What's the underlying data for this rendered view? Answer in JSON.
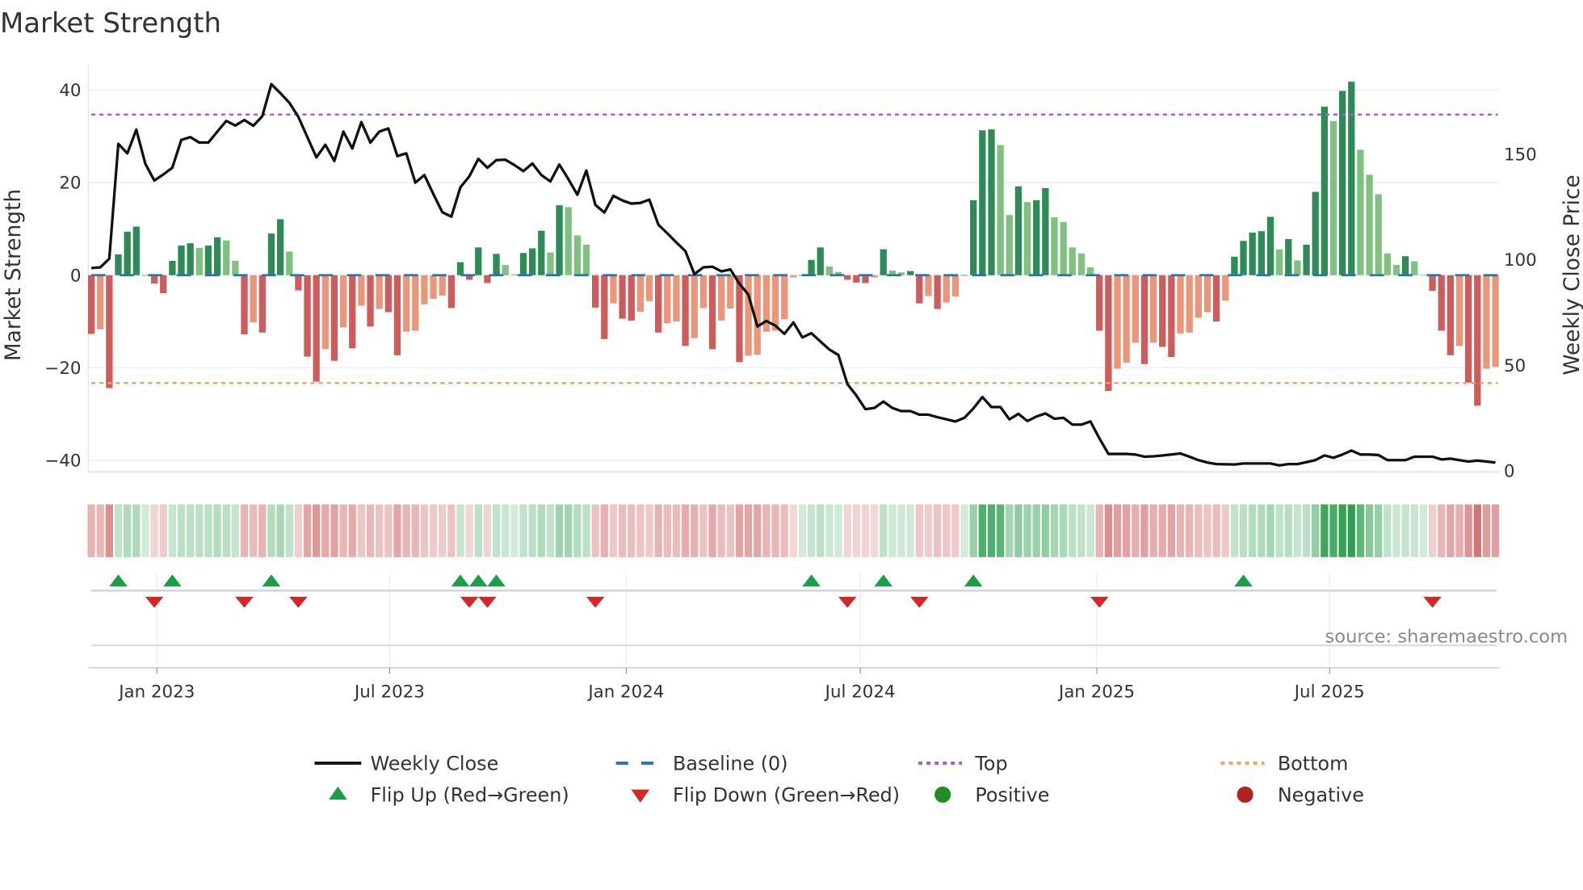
{
  "chart_data": {
    "type": "bar",
    "title": "Market Strength",
    "ylabel": "Market Strength",
    "y2label": "Weekly Close Price",
    "ylim": [
      -42.5,
      45.2
    ],
    "y2lim": [
      -0.5,
      191.8
    ],
    "yticks": [
      "40",
      "20",
      "0",
      "−20",
      "−40"
    ],
    "ytick_values": [
      40,
      20,
      0,
      -20,
      -40
    ],
    "y2ticks": [
      "150",
      "100",
      "50",
      "0"
    ],
    "y2tick_values": [
      150,
      100,
      50,
      0
    ],
    "xticks": [
      "Jan 2023",
      "Jul 2023",
      "Jan 2024",
      "Jul 2024",
      "Jan 2025",
      "Jul 2025"
    ],
    "xtick_dates": [
      "2023-01-01",
      "2023-07-01",
      "2024-01-01",
      "2024-07-01",
      "2025-01-01",
      "2025-07-01"
    ],
    "grid": true,
    "legend_placement": "bottom",
    "source": "source: sharemaestro.com",
    "top_level": 34.7,
    "bottom_level": -23.3,
    "baseline": 0,
    "colors": {
      "positive_strong": "#2e8b57",
      "positive_weak": "#80c080",
      "negative_strong": "#cd5c5c",
      "negative_weak": "#e9967a",
      "weekly_close": "#111111",
      "baseline": "#1f77b4",
      "top": "#9b5de5",
      "bottom": "#f4a261",
      "flip_up": "#1a9e4a",
      "flip_down": "#d62728",
      "positive": "#228b22",
      "negative": "#b22222"
    },
    "dates": [
      "2022-11-11",
      "2022-11-18",
      "2022-11-25",
      "2022-12-02",
      "2022-12-09",
      "2022-12-16",
      "2022-12-23",
      "2022-12-30",
      "2023-01-06",
      "2023-01-13",
      "2023-01-20",
      "2023-01-27",
      "2023-02-03",
      "2023-02-10",
      "2023-02-17",
      "2023-02-24",
      "2023-03-03",
      "2023-03-10",
      "2023-03-17",
      "2023-03-24",
      "2023-03-31",
      "2023-04-07",
      "2023-04-14",
      "2023-04-21",
      "2023-04-28",
      "2023-05-05",
      "2023-05-12",
      "2023-05-19",
      "2023-05-26",
      "2023-06-02",
      "2023-06-09",
      "2023-06-16",
      "2023-06-23",
      "2023-06-30",
      "2023-07-07",
      "2023-07-14",
      "2023-07-21",
      "2023-07-28",
      "2023-08-04",
      "2023-08-11",
      "2023-08-18",
      "2023-08-25",
      "2023-09-01",
      "2023-09-08",
      "2023-09-15",
      "2023-09-22",
      "2023-09-29",
      "2023-10-06",
      "2023-10-13",
      "2023-10-20",
      "2023-10-27",
      "2023-11-03",
      "2023-11-10",
      "2023-11-17",
      "2023-11-24",
      "2023-12-01",
      "2023-12-08",
      "2023-12-15",
      "2023-12-22",
      "2023-12-29",
      "2024-01-05",
      "2024-01-12",
      "2024-01-19",
      "2024-01-26",
      "2024-02-02",
      "2024-02-09",
      "2024-02-16",
      "2024-02-23",
      "2024-03-01",
      "2024-03-08",
      "2024-03-15",
      "2024-03-22",
      "2024-03-29",
      "2024-04-05",
      "2024-04-12",
      "2024-04-19",
      "2024-04-26",
      "2024-05-03",
      "2024-05-10",
      "2024-05-17",
      "2024-05-24",
      "2024-05-31",
      "2024-06-07",
      "2024-06-14",
      "2024-06-21",
      "2024-06-28",
      "2024-07-05",
      "2024-07-12",
      "2024-07-19",
      "2024-07-26",
      "2024-08-02",
      "2024-08-09",
      "2024-08-16",
      "2024-08-23",
      "2024-08-30",
      "2024-09-06",
      "2024-09-13",
      "2024-09-20",
      "2024-09-27",
      "2024-10-04",
      "2024-10-11",
      "2024-10-18",
      "2024-10-25",
      "2024-11-01",
      "2024-11-08",
      "2024-11-15",
      "2024-11-22",
      "2024-11-29",
      "2024-12-06",
      "2024-12-13",
      "2024-12-20",
      "2024-12-27",
      "2025-01-03",
      "2025-01-10",
      "2025-01-17",
      "2025-01-24",
      "2025-01-31",
      "2025-02-07",
      "2025-02-14",
      "2025-02-21",
      "2025-02-28",
      "2025-03-07",
      "2025-03-14",
      "2025-03-21",
      "2025-03-28",
      "2025-04-04",
      "2025-04-11",
      "2025-04-18",
      "2025-04-25",
      "2025-05-02",
      "2025-05-09",
      "2025-05-16",
      "2025-05-23",
      "2025-05-30",
      "2025-06-06",
      "2025-06-13",
      "2025-06-20",
      "2025-06-27",
      "2025-07-04",
      "2025-07-11",
      "2025-07-18",
      "2025-07-25",
      "2025-08-01",
      "2025-08-08",
      "2025-08-15",
      "2025-08-22",
      "2025-08-29",
      "2025-09-05",
      "2025-09-12",
      "2025-09-19",
      "2025-09-26",
      "2025-10-03",
      "2025-10-10",
      "2025-10-17",
      "2025-10-24",
      "2025-10-31",
      "2025-11-07"
    ],
    "strength": [
      -12.7,
      -11.7,
      -24.4,
      4.5,
      9.4,
      10.5,
      0,
      -1.8,
      -3.9,
      3.1,
      6.4,
      6.9,
      5.9,
      6.4,
      8.2,
      7.5,
      3.1,
      -12.8,
      -10.2,
      -12.4,
      9.0,
      12.1,
      5.1,
      -3.3,
      -17.6,
      -23.0,
      -16.0,
      -18.5,
      -11.3,
      -15.8,
      -6.6,
      -11.1,
      -7.3,
      -8.0,
      -17.3,
      -12.2,
      -12.0,
      -6.3,
      -5.1,
      -4.4,
      -7.1,
      2.8,
      -1.0,
      6.0,
      -1.7,
      4.6,
      2.2,
      0.2,
      4.8,
      5.8,
      9.6,
      4.9,
      15.1,
      14.7,
      8.6,
      6.6,
      -7.0,
      -13.8,
      -6.1,
      -9.4,
      -9.8,
      -7.9,
      -5.6,
      -12.4,
      -10.4,
      -10.0,
      -15.3,
      -13.6,
      -7.1,
      -16.0,
      -9.8,
      -7.2,
      -18.8,
      -17.4,
      -17.2,
      -12.2,
      -12.0,
      -9.5,
      -0.5,
      0,
      3.3,
      6.0,
      1.9,
      0.7,
      -1.0,
      -1.6,
      -1.7,
      -0.5,
      5.6,
      1.0,
      0.6,
      0.9,
      -6.1,
      -4.5,
      -7.3,
      -5.9,
      -4.6,
      0,
      16.2,
      31.3,
      31.5,
      28.1,
      13.0,
      19.2,
      15.8,
      16.2,
      18.8,
      12.5,
      11.5,
      6.0,
      4.7,
      1.7,
      -12.0,
      -25.0,
      -20.2,
      -18.9,
      -14.6,
      -19.2,
      -14.6,
      -15.5,
      -17.7,
      -12.6,
      -12.4,
      -9.2,
      -8.0,
      -10.0,
      -5.5,
      4.0,
      7.4,
      9.2,
      9.5,
      12.6,
      5.6,
      7.8,
      3.2,
      6.6,
      18.0,
      36.4,
      33.3,
      39.8,
      41.8,
      27.1,
      21.7,
      17.5,
      4.7,
      2.2,
      4.1,
      3.0,
      0.1,
      -3.4,
      -12.0,
      -17.3,
      -15.3,
      -23.2,
      -28.2,
      -20.2,
      -19.8
    ],
    "weekly_close": [
      96.1,
      96.4,
      100.5,
      154.9,
      150.4,
      161.6,
      145.5,
      137.5,
      140.4,
      143.6,
      156.8,
      158.1,
      155.5,
      155.5,
      160.7,
      165.8,
      163.6,
      166.2,
      163.5,
      168.0,
      183.2,
      178.9,
      174.4,
      167.7,
      158.1,
      148.5,
      154.5,
      146.8,
      160.7,
      152.7,
      165.2,
      155.5,
      160.7,
      162.2,
      149.1,
      150.4,
      136.5,
      140.1,
      131.1,
      122.5,
      120.4,
      134.3,
      139.5,
      147.8,
      143.6,
      147.2,
      147.4,
      144.9,
      142.0,
      145.6,
      140.1,
      137.1,
      145.1,
      138.2,
      130.8,
      142.3,
      126.0,
      122.4,
      130.3,
      128.1,
      126.6,
      126.9,
      128.5,
      116.6,
      112.5,
      108.2,
      104.1,
      93.2,
      96.4,
      96.7,
      94.5,
      95.4,
      88.7,
      83.5,
      68.4,
      71.0,
      68.8,
      64.9,
      70.3,
      63.2,
      65.2,
      61.3,
      57.5,
      54.9,
      41.1,
      35.7,
      29.2,
      29.8,
      32.8,
      29.8,
      28.3,
      28.3,
      26.6,
      26.6,
      25.4,
      24.4,
      23.4,
      25.1,
      29.6,
      35.0,
      30.2,
      30.2,
      24.4,
      27.0,
      23.6,
      25.7,
      27.2,
      24.7,
      25.1,
      21.9,
      21.9,
      23.4,
      15.4,
      8.0,
      8.0,
      8.0,
      7.7,
      6.7,
      6.9,
      7.3,
      7.7,
      8.2,
      6.7,
      5.1,
      3.9,
      3.2,
      3.1,
      3.0,
      3.5,
      3.5,
      3.5,
      3.5,
      2.6,
      3.2,
      3.2,
      4.1,
      5.1,
      7.3,
      6.2,
      7.7,
      9.6,
      7.7,
      7.7,
      7.5,
      5.1,
      5.1,
      5.1,
      6.7,
      6.7,
      6.7,
      5.4,
      5.8,
      5.1,
      4.4,
      4.9,
      4.4,
      3.9
    ],
    "flip_up": [
      "2022-12-02",
      "2023-01-13",
      "2023-03-31",
      "2023-08-25",
      "2023-09-08",
      "2023-09-22",
      "2024-05-24",
      "2024-07-19",
      "2024-09-27",
      "2025-04-25"
    ],
    "flip_down": [
      "2022-12-30",
      "2023-03-10",
      "2023-04-21",
      "2023-09-01",
      "2023-09-15",
      "2023-12-08",
      "2024-06-21",
      "2024-08-16",
      "2025-01-03",
      "2025-09-19"
    ],
    "legend": [
      {
        "label": "Weekly Close",
        "marker": "solid-line"
      },
      {
        "label": "Baseline (0)",
        "marker": "dashed-line"
      },
      {
        "label": "Top",
        "marker": "dotted-line"
      },
      {
        "label": "Bottom",
        "marker": "dotted-line"
      },
      {
        "label": "Flip Up (Red→Green)",
        "marker": "triangle-up"
      },
      {
        "label": "Flip Down (Green→Red)",
        "marker": "triangle-down"
      },
      {
        "label": "Positive",
        "marker": "circle"
      },
      {
        "label": "Negative",
        "marker": "circle"
      }
    ]
  }
}
